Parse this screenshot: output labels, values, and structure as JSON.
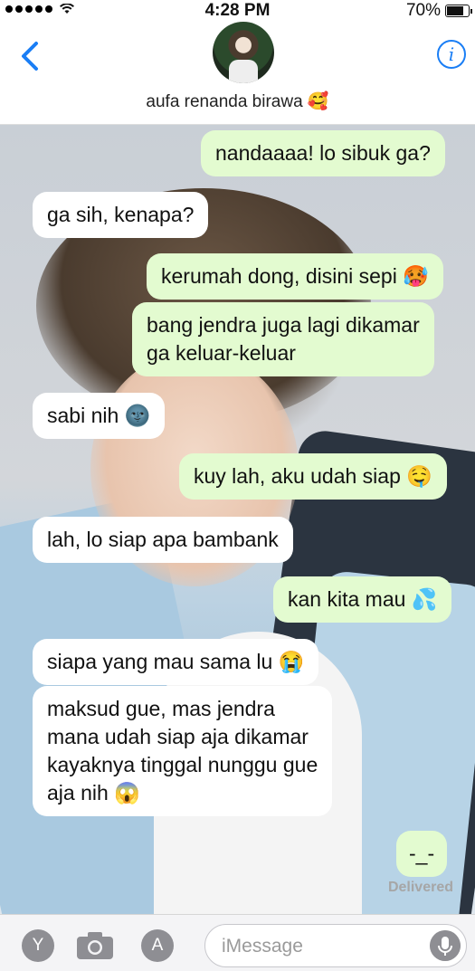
{
  "status_bar": {
    "time": "4:28 PM",
    "battery": "70%",
    "battery_level": 0.7
  },
  "header": {
    "contact_name": "aufa renanda birawa 🥰",
    "back_icon": "chevron-left-icon",
    "info_icon": "info-icon",
    "info_glyph": "i"
  },
  "messages": [
    {
      "side": "out",
      "text": "nandaaaa! lo sibuk ga?"
    },
    {
      "side": "in",
      "text": "ga sih, kenapa?"
    },
    {
      "side": "out",
      "text": "kerumah dong, disini sepi 🥵"
    },
    {
      "side": "out",
      "text": "bang jendra juga lagi dikamar\nga keluar-keluar"
    },
    {
      "side": "in",
      "text": "sabi nih 🌚"
    },
    {
      "side": "out",
      "text": "kuy lah, aku udah siap 🤤"
    },
    {
      "side": "in",
      "text": "lah, lo siap apa bambank"
    },
    {
      "side": "out",
      "text": "kan kita mau 💦"
    },
    {
      "side": "in",
      "text": "siapa yang mau sama lu 😭"
    },
    {
      "side": "in",
      "text": "maksud gue, mas jendra\nmana udah siap aja dikamar\nkayaknya tinggal nunggu gue\naja nih 😱"
    },
    {
      "side": "out",
      "text": "-_-"
    }
  ],
  "delivered": "Delivered",
  "input_bar": {
    "placeholder": "iMessage",
    "value": "",
    "left_tool_glyph": "Y",
    "app_store_glyph": "A"
  },
  "colors": {
    "incoming_bubble": "#ffffff",
    "outgoing_bubble": "#e3fbd0",
    "accent": "#1a7ef5"
  }
}
